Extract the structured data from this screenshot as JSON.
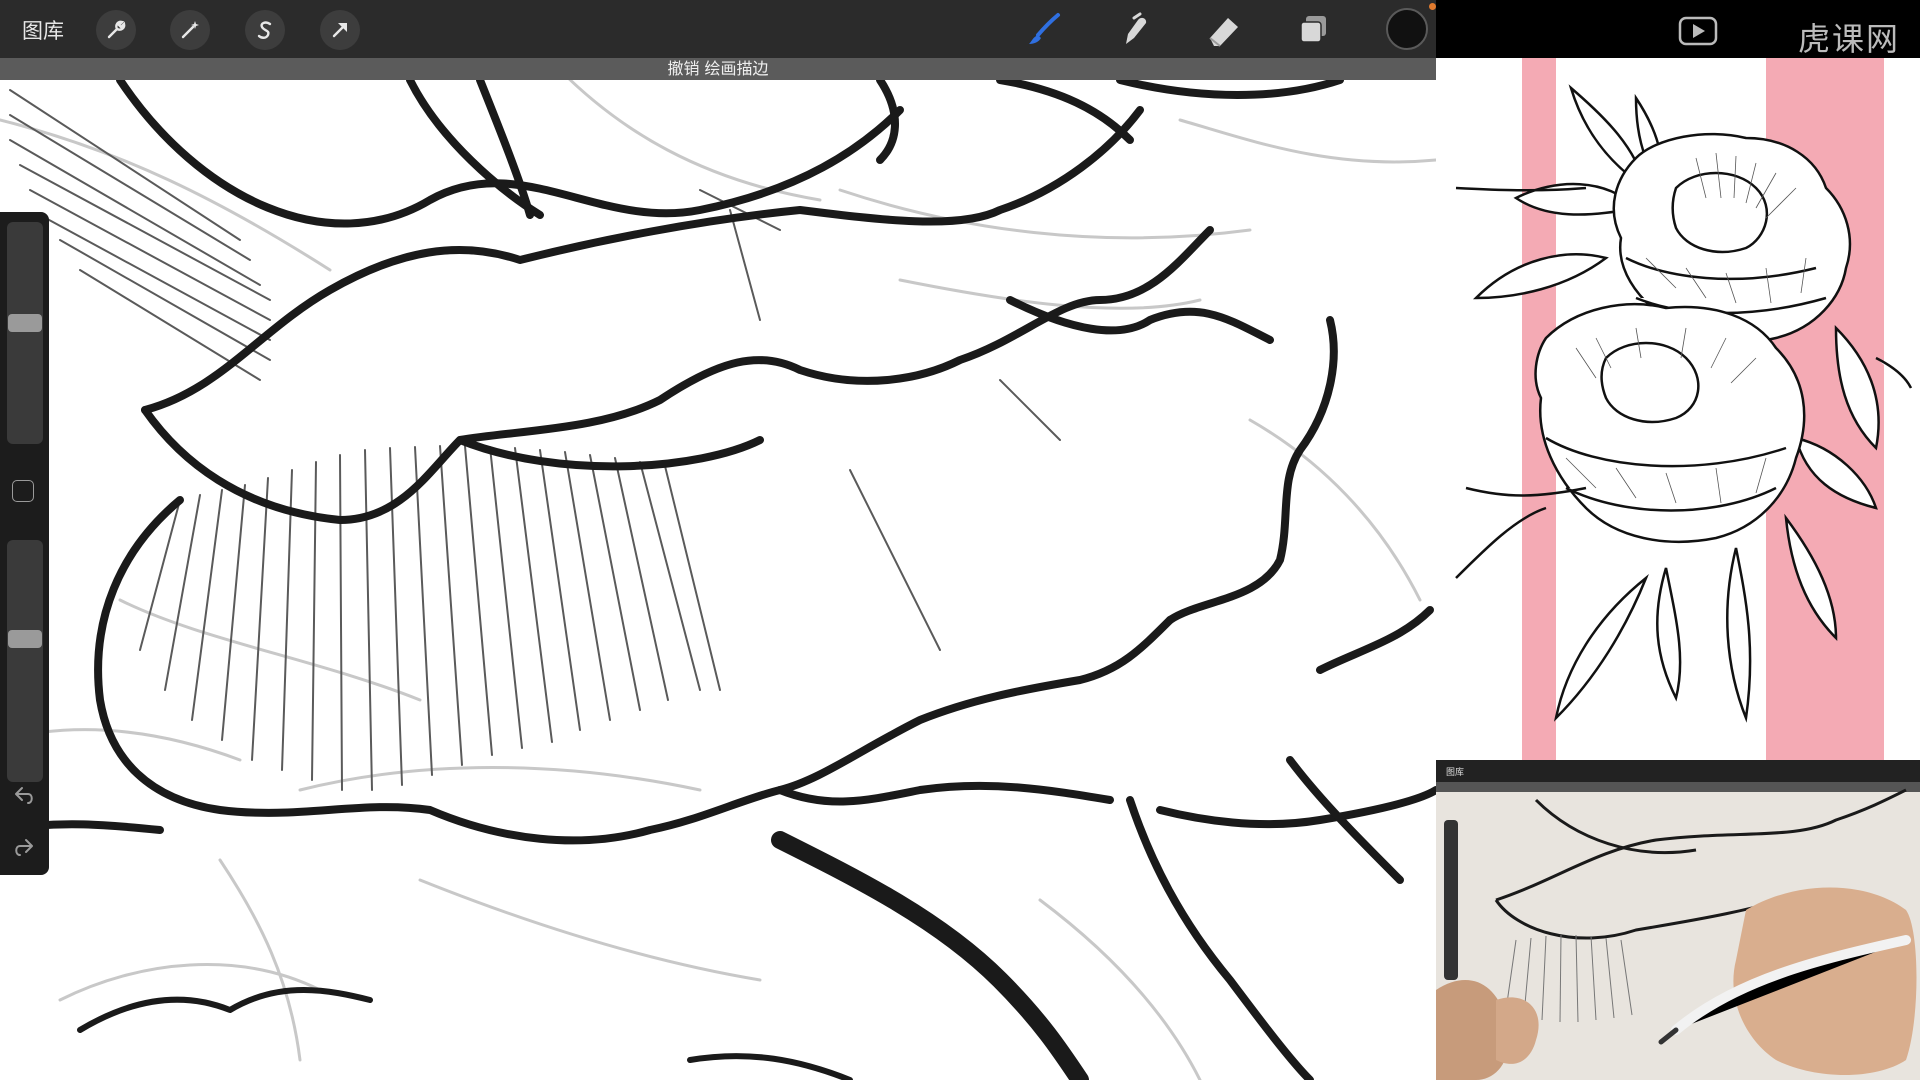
{
  "app": {
    "gallery_label": "图库",
    "undo_banner": "撤销 绘画描边"
  },
  "toolbar": {
    "left_tools": [
      "wrench-icon",
      "magic-wand-icon",
      "selection-s-icon",
      "arrow-transform-icon"
    ],
    "right_tools": [
      "brush-icon",
      "smudge-icon",
      "eraser-icon",
      "layers-icon"
    ],
    "active_tool": "brush-icon",
    "active_color": "#111111",
    "accent": "#2f6fe0"
  },
  "sidebar": {
    "brush_size_level": 0.55,
    "opacity_level": 0.4,
    "buttons": [
      "modify-square-icon",
      "undo-icon",
      "redo-icon"
    ]
  },
  "watermark": {
    "text": "虎课网"
  },
  "reference": {
    "stripe_color": "#f4aab4"
  },
  "camera": {
    "mini_gallery_label": "图库"
  }
}
